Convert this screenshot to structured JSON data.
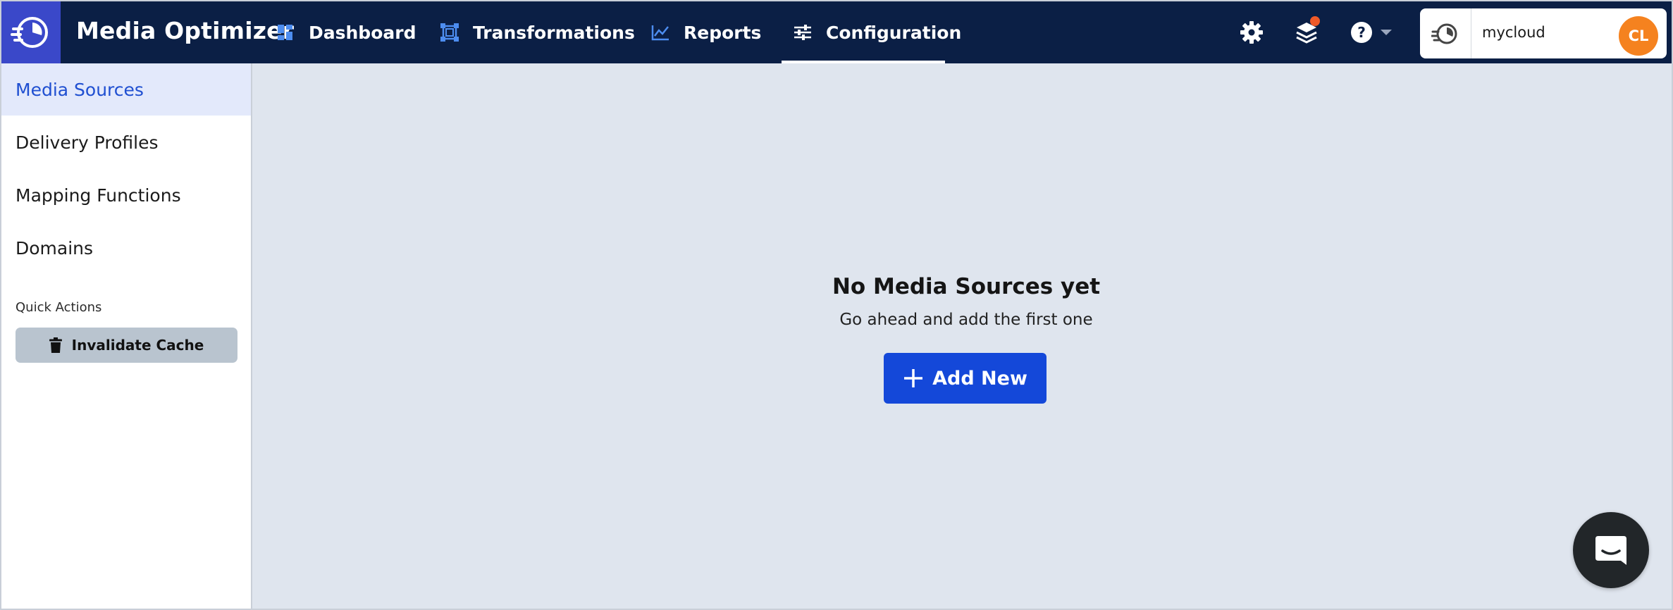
{
  "app": {
    "title": "Media Optimizer"
  },
  "nav": {
    "items": [
      {
        "label": "Dashboard",
        "icon": "dashboard-grid-icon",
        "active": false
      },
      {
        "label": "Transformations",
        "icon": "transform-frame-icon",
        "active": false
      },
      {
        "label": "Reports",
        "icon": "line-chart-icon",
        "active": false
      },
      {
        "label": "Configuration",
        "icon": "sliders-icon",
        "active": true
      }
    ]
  },
  "header_icons": [
    "gear-icon",
    "stack-icon",
    "help-icon"
  ],
  "account": {
    "name": "mycloud",
    "initials": "CL",
    "avatar_color": "#f5821f"
  },
  "sidebar": {
    "items": [
      {
        "label": "Media Sources",
        "active": true
      },
      {
        "label": "Delivery Profiles",
        "active": false
      },
      {
        "label": "Mapping Functions",
        "active": false
      },
      {
        "label": "Domains",
        "active": false
      }
    ],
    "quick_actions_title": "Quick Actions",
    "invalidate_label": "Invalidate Cache"
  },
  "empty_state": {
    "title": "No Media Sources yet",
    "subtitle": "Go ahead and add the first one",
    "add_label": "Add New"
  },
  "colors": {
    "topbar": "#0b1f45",
    "logo_bg": "#3a48c9",
    "accent": "#1448d9",
    "sidebar_active_bg": "#e3e9fb",
    "main_bg": "#dfe5ee",
    "notification": "#f05a28"
  }
}
